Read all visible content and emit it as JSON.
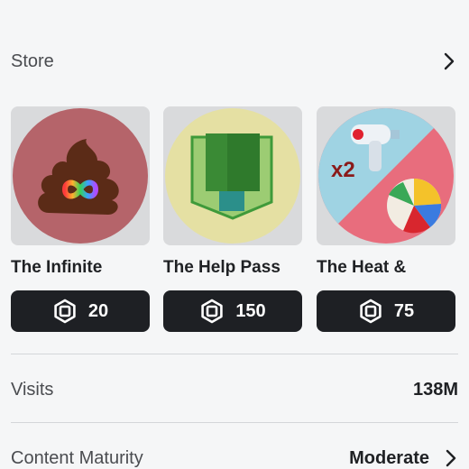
{
  "store": {
    "title": "Store"
  },
  "passes": [
    {
      "name": "The Infinite",
      "price": "20",
      "thumb_bg": "#b5646a",
      "icon": "infinity-poop-icon"
    },
    {
      "name": "The Help Pass",
      "price": "150",
      "thumb_bg": "#e5e0a3",
      "icon": "green-tree-block-icon"
    },
    {
      "name": "The Heat &",
      "price": "75",
      "thumb_bg": "#e86d7d",
      "icon": "water-gun-beach-ball-icon",
      "badge": "x2"
    }
  ],
  "visits": {
    "label": "Visits",
    "value": "138M"
  },
  "maturity": {
    "label": "Content Maturity",
    "value": "Moderate"
  },
  "colors": {
    "button_bg": "#1e2024",
    "divider": "#d4d6d9"
  }
}
